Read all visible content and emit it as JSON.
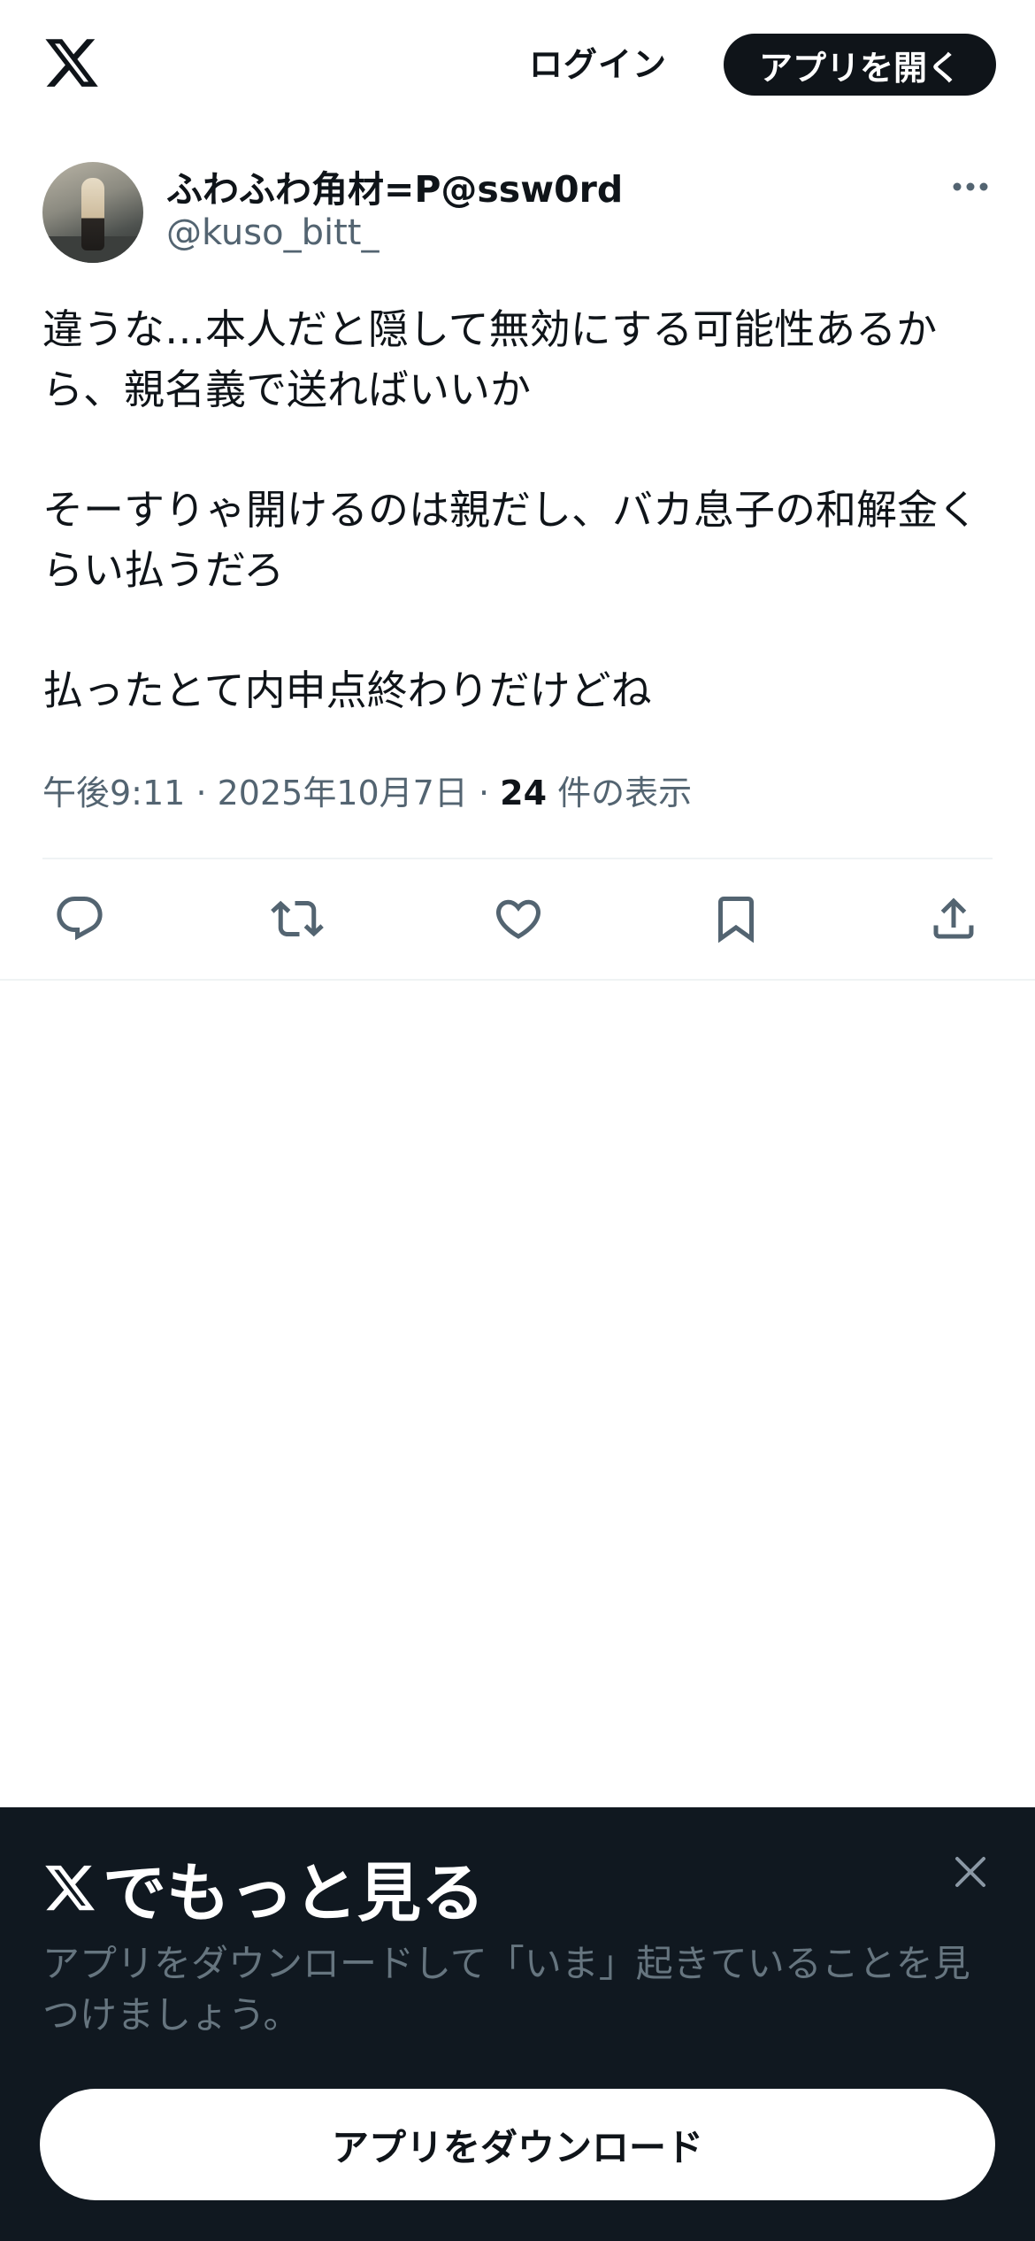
{
  "header": {
    "login_label": "ログイン",
    "open_app_label": "アプリを開く"
  },
  "tweet": {
    "display_name": "ふわふわ角材=P@ssw0rd",
    "handle": "@kuso_bitt_",
    "text": "違うな…本人だと隠して無効にする可能性あるから、親名義で送ればいいか\n\nそーすりゃ開けるのは親だし、バカ息子の和解金くらい払うだろ\n\n払ったとて内申点終わりだけどね",
    "time": "午後9:11",
    "date": "2025年10月7日",
    "separator": "·",
    "views_count": "24",
    "views_label": "件の表示"
  },
  "actions": [
    "reply-icon",
    "retweet-icon",
    "like-icon",
    "bookmark-icon",
    "share-icon"
  ],
  "banner": {
    "title": "でもっと見る",
    "subtitle": "アプリをダウンロードして「いま」起きていることを見つけましょう。",
    "download_label": "アプリをダウンロード"
  },
  "colors": {
    "text": "#0f1419",
    "secondary": "#536471",
    "banner_bg": "#101820",
    "banner_sub": "#66757f"
  }
}
